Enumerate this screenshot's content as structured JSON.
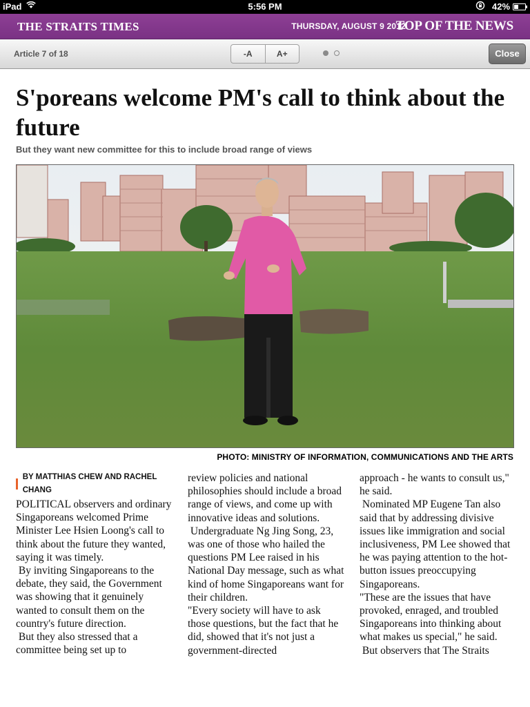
{
  "status_bar": {
    "device": "iPad",
    "time": "5:56 PM",
    "battery": "42%",
    "battery_level": 0.42
  },
  "masthead": {
    "logo": "THE STRAITS TIMES",
    "date": "THURSDAY, AUGUST 9 2012",
    "section": "TOP OF THE NEWS"
  },
  "toolbar": {
    "article_counter": "Article 7 of 18",
    "font_smaller": "-A",
    "font_larger": "A+",
    "close": "Close",
    "pages_total": 2,
    "page_current": 1
  },
  "article": {
    "headline": "S'poreans welcome PM's call to think about the future",
    "standfirst": "But they want new committee for this to include broad range of views",
    "photo_credit": "PHOTO: MINISTRY OF INFORMATION, COMMUNICATIONS AND THE ARTS",
    "byline": "BY MATTHIAS CHEW AND RACHEL CHANG",
    "col1": [
      "POLITICAL observers and ordinary Singaporeans welcomed Prime Minister Lee Hsien Loong's call to think about the future they wanted, saying it was timely.",
      " By inviting Singaporeans to the debate, they said, the Government was showing that it genuinely wanted to consult them on the country's future direction.",
      " But they also stressed that a committee being set up to"
    ],
    "col2": [
      "review policies and national philosophies should include a broad range of views, and come up with innovative ideas and solutions.",
      " Undergraduate Ng Jing Song, 23, was one of those who hailed the questions PM Lee raised in his National Day message, such as what kind of home Singaporeans want for their children.",
      "\"Every society will have to ask those questions, but the fact that he did, showed that it's not just a government-directed"
    ],
    "col3": [
      "approach - he wants to consult us,\" he said.",
      " Nominated MP Eugene Tan also said that by addressing divisive issues like immigration and social inclusiveness, PM Lee showed that he was paying attention to the hot-button issues preoccupying Singaporeans.",
      "\"These are the issues that have provoked, enraged, and troubled Singaporeans into thinking about what makes us special,\" he said.",
      " But observers that The Straits"
    ]
  }
}
